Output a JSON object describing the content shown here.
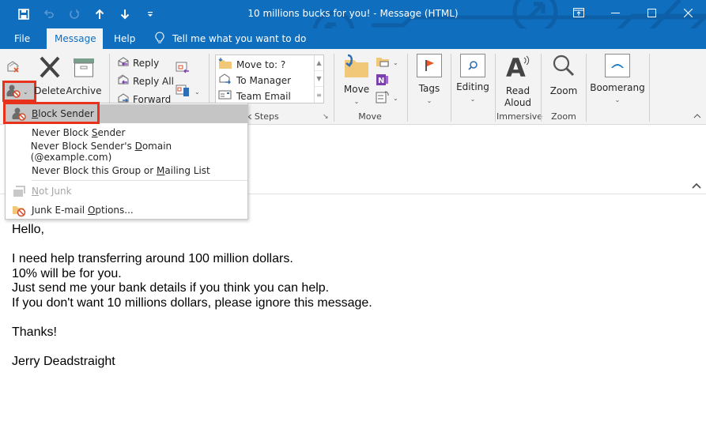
{
  "window": {
    "title": "10 millions bucks for you!  -  Message (HTML)",
    "accent_color": "#106ebe",
    "quick_access": [
      {
        "icon": "save-icon"
      },
      {
        "icon": "undo-icon"
      },
      {
        "icon": "redo-icon"
      },
      {
        "icon": "previous-item-icon"
      },
      {
        "icon": "next-item-icon"
      },
      {
        "icon": "customize-qat-icon"
      }
    ],
    "controls": [
      "ribbon-display-options",
      "minimize",
      "maximize",
      "close"
    ]
  },
  "tabs": [
    {
      "label": "File",
      "active": false
    },
    {
      "label": "Message",
      "active": true
    },
    {
      "label": "Help",
      "active": false
    }
  ],
  "tell_me": "Tell me what you want to do",
  "ribbon": {
    "delete_group": {
      "ignore_icon": "ignore-icon",
      "junk_icon": "junk-block-icon",
      "delete": "Delete",
      "archive": "Archive"
    },
    "respond_group": {
      "reply": "Reply",
      "reply_all": "Reply All",
      "forward": "Forward"
    },
    "quick_steps_group": {
      "items": [
        "Move to: ?",
        "To Manager",
        "Team Email"
      ],
      "label": "Quick Steps"
    },
    "move_group": {
      "move": "Move",
      "label": "Move"
    },
    "tags": "Tags",
    "editing": "Editing",
    "immersive_group": {
      "read_aloud_line1": "Read",
      "read_aloud_line2": "Aloud",
      "label": "Immersive"
    },
    "zoom_group": {
      "zoom": "Zoom",
      "label": "Zoom"
    },
    "boomerang": "Boomerang"
  },
  "junk_menu": {
    "items": [
      {
        "pre": "",
        "ul": "B",
        "post": "lock Sender",
        "state": "hover",
        "icon": "block-sender-icon"
      },
      {
        "pre": "Never Block ",
        "ul": "S",
        "post": "ender",
        "state": "normal",
        "icon": ""
      },
      {
        "pre": "Never Block Sender's ",
        "ul": "D",
        "post": "omain (@example.com)",
        "state": "normal",
        "icon": ""
      },
      {
        "pre": "Never Block this Group or ",
        "ul": "M",
        "post": "ailing List",
        "state": "normal",
        "icon": ""
      },
      {
        "pre": "",
        "ul": "N",
        "post": "ot Junk",
        "state": "disabled",
        "icon": "not-junk-icon"
      },
      {
        "pre": "Junk E-mail ",
        "ul": "O",
        "post": "ptions...",
        "state": "normal",
        "icon": "junk-options-icon"
      }
    ]
  },
  "message": {
    "lines": [
      "Hello,",
      "",
      "I need help transferring around 100 million dollars.",
      "10% will be for you.",
      "Just send me your bank details if you think you can help.",
      "If you don't want 10 millions dollars, please ignore this message.",
      "",
      "Thanks!",
      "",
      "Jerry Deadstraight"
    ]
  }
}
